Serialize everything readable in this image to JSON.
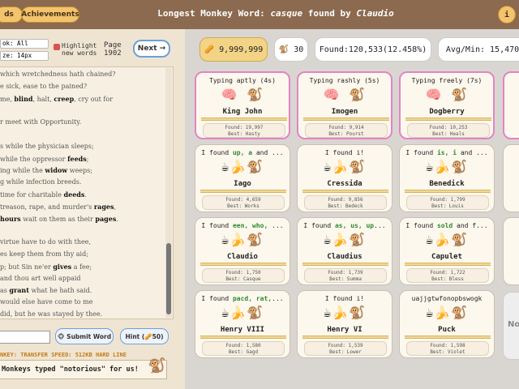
{
  "topbar": {
    "left_button_label": "ds",
    "achievements_label": "Achievements",
    "title_prefix": "Longest Monkey Word: ",
    "title_word": "casque",
    "title_middle": " found by ",
    "title_name": "Claudio",
    "info_label": "i"
  },
  "controls": {
    "book_label": "ok: All",
    "size_label": "ze: 14px",
    "highlight_label_1": "Highlight",
    "highlight_label_2": "new words",
    "page_label": "Page",
    "page_number": "1902",
    "next_label": "Next →"
  },
  "poem": [
    {
      "text": " which wretchedness hath chained?",
      "bold": []
    },
    {
      "text": "e sick, ease to the pained?",
      "bold": []
    },
    {
      "text": "me, blind, halt, creep, cry out for",
      "bold": [
        "blind",
        "creep"
      ]
    },
    {
      "text": "",
      "bold": []
    },
    {
      "text": "r meet with Opportunity.",
      "bold": []
    },
    {
      "text": "",
      "bold": []
    },
    {
      "text": "s while the physician sleeps;",
      "bold": []
    },
    {
      "text": " while the oppressor feeds;",
      "bold": [
        "feeds"
      ]
    },
    {
      "text": "ing while the widow weeps;",
      "bold": [
        "widow"
      ]
    },
    {
      "text": "g while infection breeds.",
      "bold": []
    },
    {
      "text": " time for charitable deeds.",
      "bold": [
        "deeds"
      ]
    },
    {
      "text": " treason, rape, and murder's rages,",
      "bold": [
        "rages"
      ]
    },
    {
      "text": "hours wait on them as their pages.",
      "bold": [
        "hours",
        "pages"
      ]
    },
    {
      "text": "",
      "bold": []
    },
    {
      "text": "virtue have to do with thee,",
      "bold": []
    },
    {
      "text": "es keep them from thy aid;",
      "bold": []
    },
    {
      "text": "p; but Sin ne'er gives a fee;",
      "bold": [
        "gives"
      ]
    },
    {
      "text": " and thou art well appaid",
      "bold": []
    },
    {
      "text": "as grant what he hath said.",
      "bold": [
        "grant"
      ]
    },
    {
      "text": " would else have come to me",
      "bold": []
    },
    {
      "text": " did, but he was stayed by thee.",
      "bold": []
    }
  ],
  "input": {
    "submit_label": "🐵 Submit Word",
    "hint_label": "Hint (🥜50)"
  },
  "ticker": "NKEY: TRANSFER SPEED: 512KB HARD LINE",
  "message": "Monkeys typed \"notorious\" for us!",
  "stats": {
    "coins": "9,999,999",
    "monkeys": "30",
    "found": "Found:120,533(12.458%)",
    "avg": "Avg/Min: 15,470"
  },
  "monkeys": [
    {
      "head": "Typing aptly (4s)",
      "typing": true,
      "name": "King John",
      "found": "Found: 19,997",
      "best": "Best: Hasty"
    },
    {
      "head": "Typing rashly (5s)",
      "typing": true,
      "name": "Imogen",
      "found": "Found: 9,914",
      "best": "Best: Pourst"
    },
    {
      "head": "Typing freely (7s)",
      "typing": true,
      "name": "Dogberry",
      "found": "Found: 10,253",
      "best": "Best: Heals"
    },
    {
      "head_pre": "I found ",
      "head_bold": "up, a",
      "head_post": " and ...",
      "typing": false,
      "name": "Iago",
      "found": "Found: 4,659",
      "best": "Best: Works"
    },
    {
      "head_pre": "I found ",
      "head_bold": "",
      "head_post": "i!",
      "typing": false,
      "name": "Cressida",
      "found": "Found: 9,856",
      "best": "Best: Bedeck"
    },
    {
      "head_pre": "I found ",
      "head_bold": "is, i",
      "head_post": " and ...",
      "typing": false,
      "name": "Benedick",
      "found": "Found: 1,799",
      "best": "Best: Louis"
    },
    {
      "head_pre": "I found ",
      "head_bold": "een, who,",
      "head_post": " ...",
      "typing": false,
      "name": "Claudio",
      "found": "Found: 1,750",
      "best": "Best: Casque"
    },
    {
      "head_pre": "I found ",
      "head_bold": "as, us, up",
      "head_post": "...",
      "typing": false,
      "name": "Claudius",
      "found": "Found: 1,739",
      "best": "Best: Summa"
    },
    {
      "head_pre": "I found ",
      "head_bold": "sold",
      "head_post": " and f...",
      "typing": false,
      "name": "Capulet",
      "found": "Found: 1,722",
      "best": "Best: Bless"
    },
    {
      "head_pre": "I found ",
      "head_bold": "pacd, rat,",
      "head_post": "...",
      "typing": false,
      "name": "Henry VIII",
      "found": "Found: 1,580",
      "best": "Best: Gagd"
    },
    {
      "head_pre": "I found ",
      "head_bold": "",
      "head_post": "i!",
      "typing": false,
      "name": "Henry VI",
      "found": "Found: 1,539",
      "best": "Best: Lower"
    },
    {
      "head_pre": "uajjgtwfonopbswogk",
      "head_bold": "",
      "head_post": "",
      "typing": false,
      "name": "Puck",
      "found": "Found: 1,598",
      "best": "Best: Violet"
    }
  ],
  "icons": {
    "brain": "🧠",
    "coffee": "☕",
    "banana": "🍌",
    "monkey": "🐒",
    "peanut": "🥜"
  },
  "grey_card_label": "No",
  "colors": {
    "topbar": "#8b6a4f",
    "button_gold": "#f2c46d",
    "typing_border": "#e384c4",
    "found_green": "#2f8a2f",
    "ticker_orange": "#c47b16"
  }
}
